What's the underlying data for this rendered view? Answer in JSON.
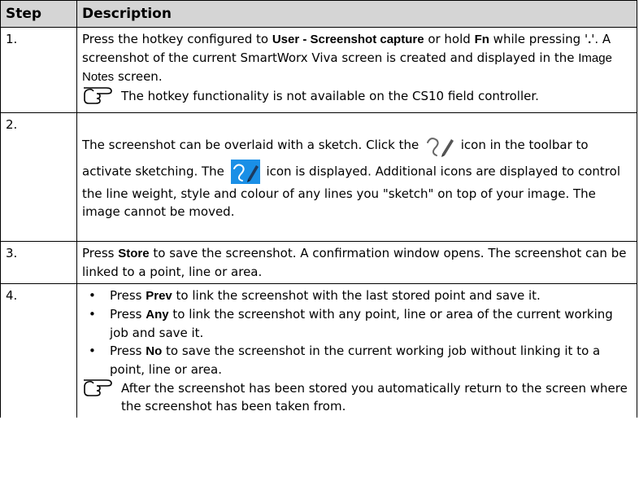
{
  "header": {
    "step": "Step",
    "description": "Description"
  },
  "rows": [
    {
      "step": "1.",
      "text_a": "Press the hotkey configured to ",
      "bold_a": "User - Screenshot capture",
      "text_b": " or hold ",
      "bold_b": "Fn",
      "text_c": " while pressing '",
      "bold_c": ".",
      "text_d": "'. A screenshot of the current SmartWorx Viva screen is created and displayed in the ",
      "screen_name": "Image Notes",
      "text_e": " screen.",
      "note": "The hotkey functionality is not available on the CS10 field controller."
    },
    {
      "step": "2.",
      "text_a": "The screenshot can be overlaid with a sketch. Click the ",
      "text_b": " icon in the toolbar to activate sketching. The ",
      "text_c": " icon is displayed. Additional icons are displayed to control the line weight, style and colour of any lines you \"sketch\" on top of your image. The image cannot be moved.",
      "icon_inactive": "sketch-pen-icon",
      "icon_active": "sketch-pen-active-icon",
      "active_icon_bg": "#1a8fe6"
    },
    {
      "step": "3.",
      "text_a": "Press ",
      "bold_a": "Store",
      "text_b": " to save the screenshot. A confirmation window opens. The screenshot can be linked to a point, line or area."
    },
    {
      "step": "4.",
      "bullets": [
        {
          "pre": "Press ",
          "bold": "Prev",
          "post": " to link the screenshot with the last stored point and save it."
        },
        {
          "pre": "Press ",
          "bold": "Any",
          "post": " to link the screenshot with any point, line or area of the current working job and save it."
        },
        {
          "pre": "Press ",
          "bold": "No",
          "post": " to save the screenshot in the current working job without linking it to a point, line or area."
        }
      ],
      "note": "After the screenshot has been stored you automatically return to the screen where the screenshot has been taken from."
    }
  ],
  "colors": {
    "header_bg": "#d5d5d5",
    "border": "#000000"
  },
  "note_icon": "pointing-hand-icon"
}
